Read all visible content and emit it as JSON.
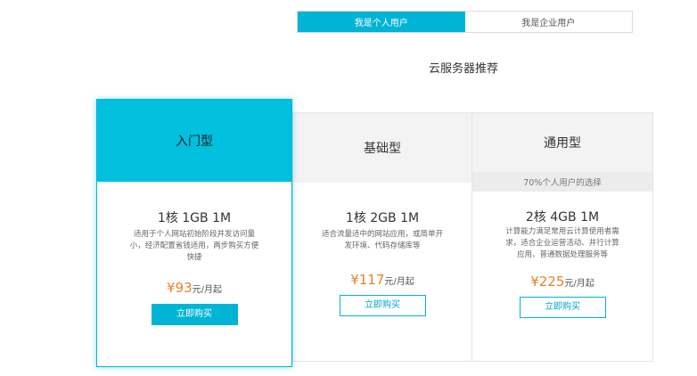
{
  "tabs": [
    {
      "label": "我是个人用户",
      "active": true
    },
    {
      "label": "我是企业用户",
      "active": false
    }
  ],
  "section_title": "云服务器推荐",
  "plans": [
    {
      "name": "入门型",
      "spec": "1核 1GB 1M",
      "desc": "适用于个人网站初始阶段并发访问量小，经济配置省钱适用，两步购买方便快捷",
      "price": "¥93",
      "unit": "元/月起",
      "button": "立即购买",
      "featured": true
    },
    {
      "name": "基础型",
      "spec": "1核 2GB 1M",
      "desc": "适合流量适中的网站应用，或简单开发环境、代码存储库等",
      "price": "¥117",
      "unit": "元/月起",
      "button": "立即购买",
      "featured": false
    },
    {
      "name": "通用型",
      "tag": "70%个人用户的选择",
      "spec": "2核 4GB 1M",
      "desc": "计算能力满足常用云计算使用者需求，适合企业运营活动、并行计算应用、普通数据处理服务等",
      "price": "¥225",
      "unit": "元/月起",
      "button": "立即购买",
      "featured": false
    }
  ],
  "colors": {
    "accent": "#00b4d6",
    "featured_header": "#00c0de",
    "price": "#e9822a"
  }
}
